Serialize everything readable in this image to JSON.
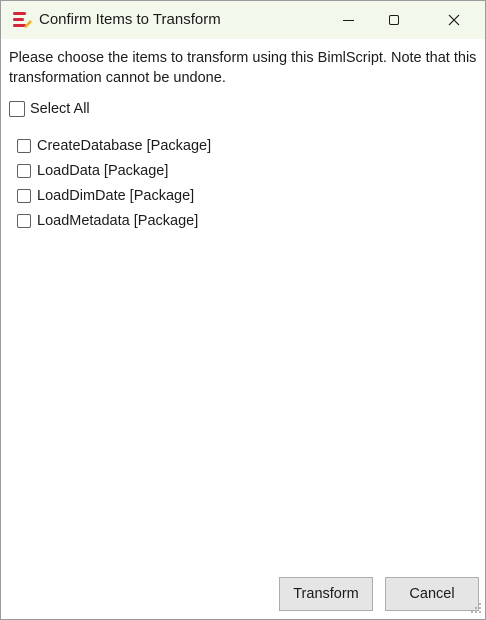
{
  "window": {
    "title": "Confirm Items to Transform",
    "accent_color": "#f3f8ec"
  },
  "titlebar_buttons": {
    "minimize_icon": "minimize-icon",
    "maximize_icon": "maximize-icon",
    "close_icon": "close-icon"
  },
  "message": "Please choose the items to transform using this BimlScript. Note that this transformation cannot be undone.",
  "select_all": {
    "label": "Select All",
    "checked": false
  },
  "items": [
    {
      "label": "CreateDatabase [Package]",
      "checked": false
    },
    {
      "label": "LoadData [Package]",
      "checked": false
    },
    {
      "label": "LoadDimDate [Package]",
      "checked": false
    },
    {
      "label": "LoadMetadata [Package]",
      "checked": false
    }
  ],
  "buttons": {
    "transform": "Transform",
    "cancel": "Cancel"
  }
}
